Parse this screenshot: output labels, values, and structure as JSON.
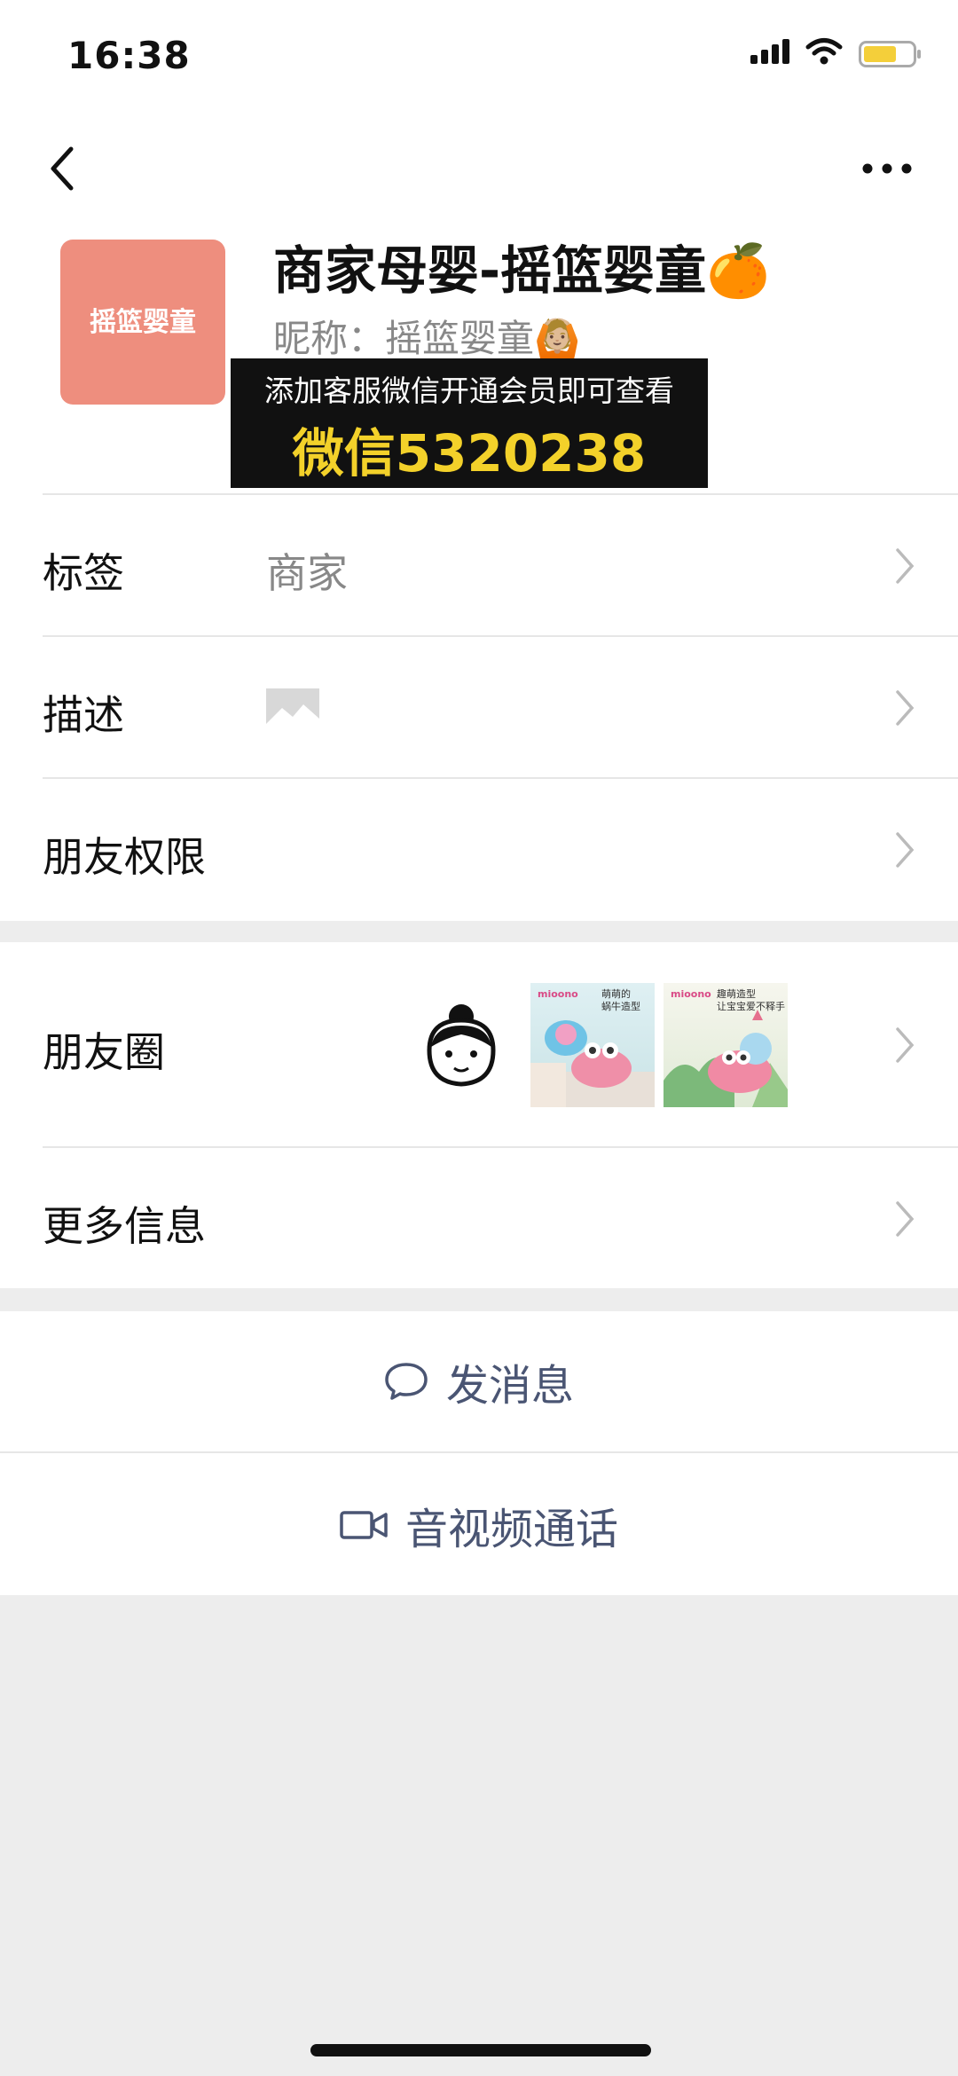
{
  "status_bar": {
    "time": "16:38"
  },
  "profile": {
    "name": "商家母婴-摇篮婴童🍊",
    "nickname": "昵称：摇篮婴童🙆🏼",
    "avatar_text": "摇篮婴童"
  },
  "banner": {
    "line1": "添加客服微信开通会员即可查看",
    "line2": "微信5320238"
  },
  "rows": {
    "tags_label": "标签",
    "tags_value": "商家",
    "desc_label": "描述",
    "perm_label": "朋友权限",
    "moments_label": "朋友圈",
    "more_label": "更多信息"
  },
  "thumbs": [
    {
      "brand": "mioono",
      "caption": "萌萌的\n蜗牛造型"
    },
    {
      "brand": "mioono",
      "caption": "趣萌造型\n让宝宝爱不释手"
    }
  ],
  "actions": {
    "message": "发消息",
    "call": "音视频通话"
  },
  "colors": {
    "avatar_bg": "#ee8e7e",
    "banner_bg": "#111111",
    "banner_accent": "#f3d12a",
    "action_text": "#4a5573"
  }
}
